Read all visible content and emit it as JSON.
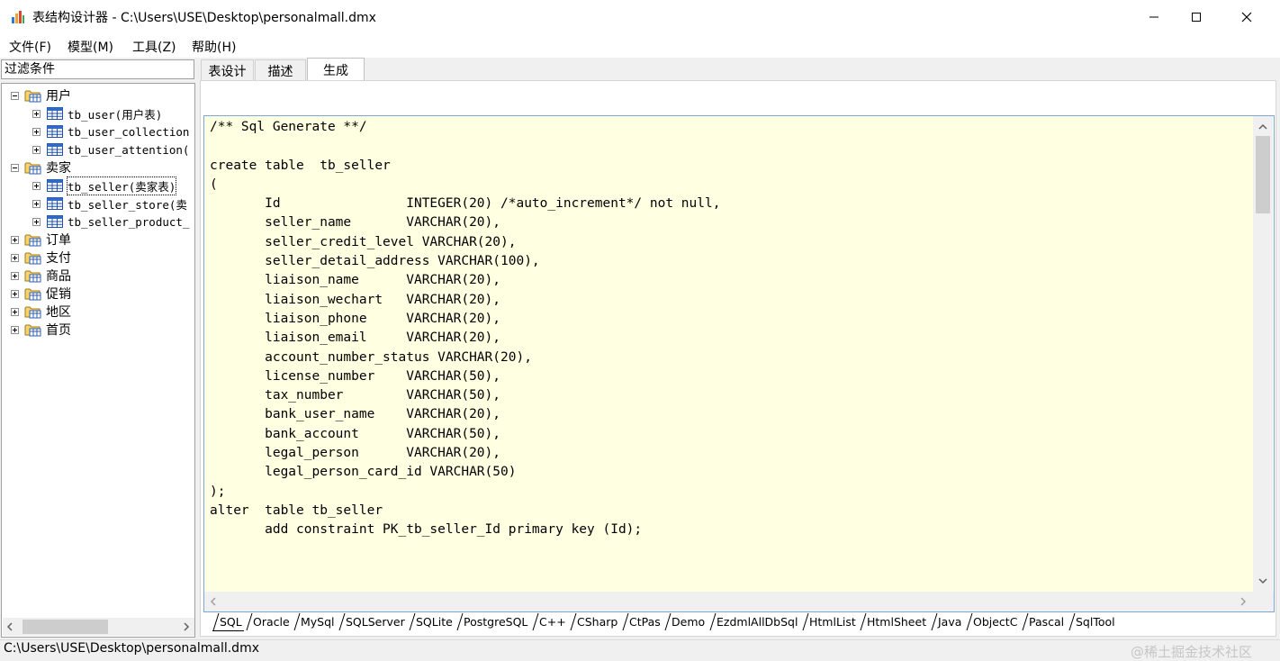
{
  "window": {
    "title": "表结构设计器 - C:\\Users\\USE\\Desktop\\personalmall.dmx"
  },
  "menu": [
    "文件(F)",
    "模型(M)",
    "工具(Z)",
    "帮助(H)"
  ],
  "filter": {
    "label": "过滤条件"
  },
  "tree": {
    "groups": [
      {
        "label": "用户",
        "expanded": true,
        "children": [
          "tb_user(用户表)",
          "tb_user_collection",
          "tb_user_attention("
        ]
      },
      {
        "label": "卖家",
        "expanded": true,
        "children": [
          "tb_seller(卖家表)",
          "tb_seller_store(卖",
          "tb_seller_product_"
        ]
      },
      {
        "label": "订单",
        "expanded": false,
        "children": []
      },
      {
        "label": "支付",
        "expanded": false,
        "children": []
      },
      {
        "label": "商品",
        "expanded": false,
        "children": []
      },
      {
        "label": "促销",
        "expanded": false,
        "children": []
      },
      {
        "label": "地区",
        "expanded": false,
        "children": []
      },
      {
        "label": "首页",
        "expanded": false,
        "children": []
      }
    ],
    "selected": "tb_seller(卖家表)"
  },
  "tabs": [
    "表设计",
    "描述",
    "生成"
  ],
  "active_tab": "生成",
  "editor": {
    "code": "/** Sql Generate **/\n\ncreate table  tb_seller\n(\n       Id                INTEGER(20) /*auto_increment*/ not null,\n       seller_name       VARCHAR(20),\n       seller_credit_level VARCHAR(20),\n       seller_detail_address VARCHAR(100),\n       liaison_name      VARCHAR(20),\n       liaison_wechart   VARCHAR(20),\n       liaison_phone     VARCHAR(20),\n       liaison_email     VARCHAR(20),\n       account_number_status VARCHAR(20),\n       license_number    VARCHAR(50),\n       tax_number        VARCHAR(50),\n       bank_user_name    VARCHAR(20),\n       bank_account      VARCHAR(50),\n       legal_person      VARCHAR(20),\n       legal_person_card_id VARCHAR(50)\n);\nalter  table tb_seller\n       add constraint PK_tb_seller_Id primary key (Id);"
  },
  "lang_tabs": [
    "SQL",
    "Oracle",
    "MySql",
    "SQLServer",
    "SQLite",
    "PostgreSQL",
    "C++",
    "CSharp",
    "CtPas",
    "Demo",
    "EzdmlAllDbSql",
    "HtmlList",
    "HtmlSheet",
    "Java",
    "ObjectC",
    "Pascal",
    "SqlTool"
  ],
  "active_lang": "SQL",
  "status": {
    "path": "C:\\Users\\USE\\Desktop\\personalmall.dmx",
    "watermark": "@稀土掘金技术社区"
  }
}
